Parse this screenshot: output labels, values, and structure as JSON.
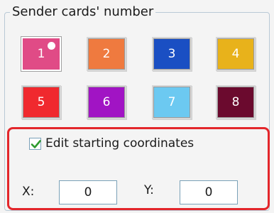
{
  "group": {
    "title": "Sender cards' number"
  },
  "cards": [
    {
      "label": "1",
      "color": "#e04b86",
      "selected": true
    },
    {
      "label": "2",
      "color": "#ef7a3f",
      "selected": false
    },
    {
      "label": "3",
      "color": "#1a4fc3",
      "selected": false
    },
    {
      "label": "4",
      "color": "#e8b21b",
      "selected": false
    },
    {
      "label": "5",
      "color": "#f0292e",
      "selected": false
    },
    {
      "label": "6",
      "color": "#a114c4",
      "selected": false
    },
    {
      "label": "7",
      "color": "#6cc9f1",
      "selected": false
    },
    {
      "label": "8",
      "color": "#6b0a2e",
      "selected": false
    }
  ],
  "coords": {
    "edit_label": "Edit starting coordinates",
    "edit_checked": true,
    "x_label": "X:",
    "x_value": "0",
    "y_label": "Y:",
    "y_value": "0"
  },
  "colors": {
    "highlight_frame": "#e3262b",
    "check": "#2e9a2e"
  }
}
